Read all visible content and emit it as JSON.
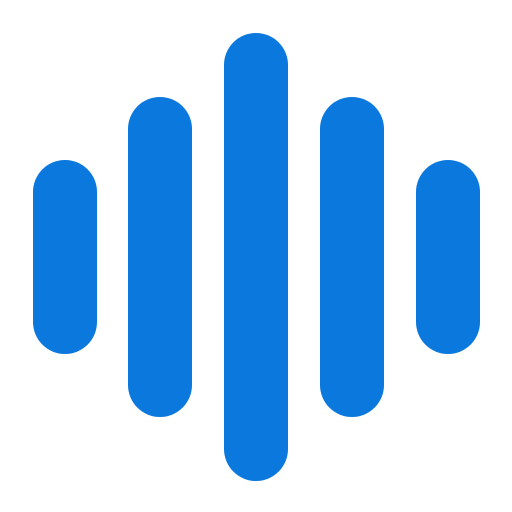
{
  "icon": {
    "name": "audio-waveform-icon",
    "color": "#0A78DC",
    "background": "#FFFFFF",
    "bar_count": 5
  }
}
